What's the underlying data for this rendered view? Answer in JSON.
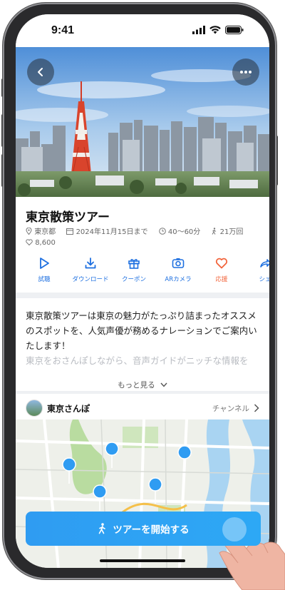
{
  "status": {
    "time": "9:41"
  },
  "tour": {
    "title": "東京散策ツアー",
    "location": "東京都",
    "date": "2024年11月15日まで",
    "duration": "40〜60分",
    "walks": "21万回",
    "likes": "8,600"
  },
  "actions": [
    {
      "label": "試聴",
      "icon": "play-icon",
      "color": "#1d6fe0"
    },
    {
      "label": "ダウンロード",
      "icon": "download-icon",
      "color": "#1d6fe0"
    },
    {
      "label": "クーポン",
      "icon": "gift-icon",
      "color": "#1d6fe0"
    },
    {
      "label": "ARカメラ",
      "icon": "camera-icon",
      "color": "#1d6fe0"
    },
    {
      "label": "応援",
      "icon": "heart-icon",
      "color": "#f2643b"
    },
    {
      "label": "シェ",
      "icon": "share-icon",
      "color": "#1d6fe0"
    }
  ],
  "description": {
    "text": "東京散策ツアーは東京の魅力がたっぷり詰まったオススメのスポットを、人気声優が務めるナレーションでご案内いたします！",
    "faded": "東京をおさんぽしながら、音声ガイドがニッチな情報を",
    "more": "もっと見る"
  },
  "channel": {
    "name": "東京さんぽ",
    "link": "チャンネル"
  },
  "cta": {
    "label": "ツアーを開始する"
  },
  "colors": {
    "accent": "#1d6fe0",
    "cta": "#2f9cf2",
    "heart": "#f2643b"
  }
}
